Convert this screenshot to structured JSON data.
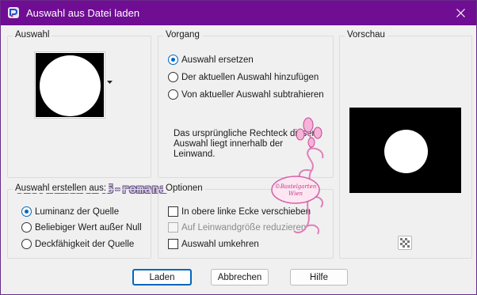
{
  "window": {
    "title": "Auswahl aus Datei laden",
    "titlebar_color": "#6f0d93",
    "accent": "#0067c0"
  },
  "auswahl": {
    "label": "Auswahl"
  },
  "vorgang": {
    "label": "Vorgang",
    "options": [
      {
        "label": "Auswahl ersetzen",
        "checked": true
      },
      {
        "label": "Der aktuellen Auswahl hinzufügen",
        "checked": false
      },
      {
        "label": "Von aktueller Auswahl subtrahieren",
        "checked": false
      }
    ],
    "info": "Das ursprüngliche Rechteck dieser Auswahl liegt innerhalb der Leinwand.",
    "info_lines": [
      "Das ursprüngliche Rechteck dieser",
      "Auswahl liegt innerhalb der",
      "Leinwand."
    ]
  },
  "vorschau": {
    "label": "Vorschau"
  },
  "erstellen": {
    "label": "Auswahl erstellen aus:",
    "options": [
      {
        "label": "Luminanz der Quelle",
        "checked": true
      },
      {
        "label": "Beliebiger Wert außer Null",
        "checked": false
      },
      {
        "label": "Deckfähigkeit der Quelle",
        "checked": false
      }
    ]
  },
  "optionen": {
    "label": "Optionen",
    "checks": [
      {
        "label": "In obere linke Ecke verschieben",
        "checked": false,
        "disabled": false
      },
      {
        "label": "Auf Leinwandgröße reduzieren",
        "checked": false,
        "disabled": true
      },
      {
        "label": "Auswahl umkehren",
        "checked": false,
        "disabled": false
      }
    ]
  },
  "buttons": {
    "ok": "Laden",
    "cancel": "Abbrechen",
    "help": "Hilfe"
  },
  "watermark": {
    "text": "01ornament145-romana"
  }
}
